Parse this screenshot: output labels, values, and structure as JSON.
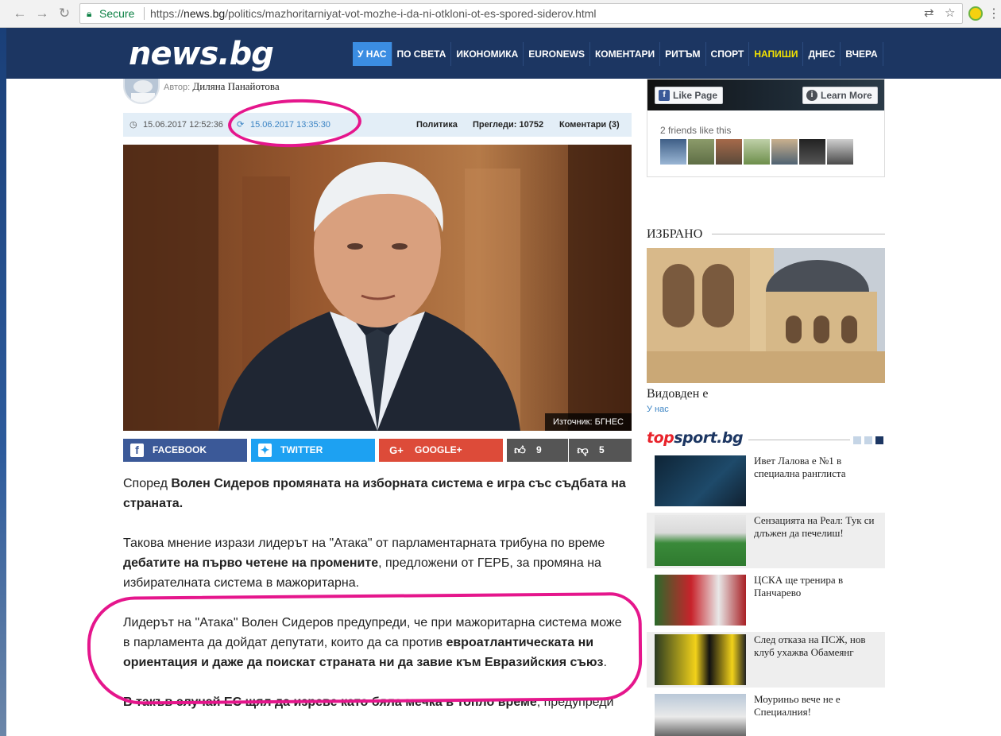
{
  "browser": {
    "secure_label": "Secure",
    "url_prefix": "https://",
    "url_host": "news.bg",
    "url_path": "/politics/mazhoritarniyat-vot-mozhe-i-da-ni-otkloni-ot-es-spored-siderov.html"
  },
  "site": {
    "logo": "news.bg",
    "nav": [
      "У НАС",
      "ПО СВЕТА",
      "ИКОНОМИКА",
      "EURONEWS",
      "КОМЕНТАРИ",
      "РИТЪМ",
      "СПОРТ",
      "НАПИШИ",
      "ДНЕС",
      "ВЧЕРА"
    ],
    "nav_active_index": 0,
    "nav_highlight_index": 7,
    "accent_color": "#3b8de2",
    "header_color": "#1c3662",
    "highlight_color": "#e5168c"
  },
  "article": {
    "author_label": "Автор:",
    "author_name": "Диляна Панайотова",
    "published": "15.06.2017 12:52:36",
    "updated": "15.06.2017 13:35:30",
    "category": "Политика",
    "views_label": "Прегледи:",
    "views": "10752",
    "comments_label": "Коментари",
    "comments_count": "(3)",
    "image_credit_label": "Източник:",
    "image_credit": "БГНЕС",
    "share": {
      "facebook": "FACEBOOK",
      "twitter": "TWITTER",
      "google": "GOOGLE+",
      "likes": "9",
      "dislikes": "5"
    },
    "p1_a": "Според ",
    "p1_b": "Волен Сидеров промяната на изборната система е игра със съдбата на страната.",
    "p2_a": "Такова мнение изрази лидерът на \"Атака\" от парламентарната трибуна по време ",
    "p2_b": "дебатите на първо четене на промените",
    "p2_c": ", предложени от ГЕРБ, за промяна на избирателната система в мажоритарна.",
    "p3_a": "Лидерът на \"Атака\" Волен Сидеров предупреди, че при мажоритарна система може в парламента да дойдат депутати, които да са против ",
    "p3_b": "евроатлантическата ни ориентация и даже да поискат страната ни да завие към Евразийския съюз",
    "p3_c": ".",
    "p4_a": "В такъв случай ЕС щял да изреве като бяла мечка в топло време",
    "p4_b": ", предупреди"
  },
  "sidebar": {
    "fb_like": "Like Page",
    "fb_learn": "Learn More",
    "fb_friends": "2 friends like this",
    "izbrano_title": "ИЗБРАНО",
    "izbrano_headline": "Видовден е",
    "izbrano_category": "У нас",
    "topsport_logo_a": "top",
    "topsport_logo_b": "sport.bg",
    "sport_items": [
      "Ивет Лалова е №1 в специална ранглиста",
      "Сензацията на Реал: Тук си длъжен да печелиш!",
      "ЦСКА ще тренира в Панчарево",
      "След отказа на ПСЖ, нов клуб ухажва Обамеянг",
      "Моуриньо вече не е Специалния!"
    ]
  }
}
